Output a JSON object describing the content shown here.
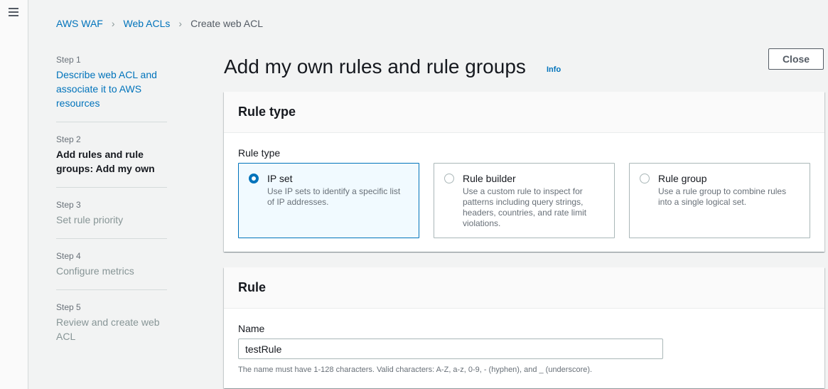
{
  "nav": {
    "menu_icon": "hamburger-menu-icon"
  },
  "breadcrumb": {
    "items": [
      {
        "label": "AWS WAF",
        "link": true
      },
      {
        "label": "Web ACLs",
        "link": true
      },
      {
        "label": "Create web ACL",
        "link": false
      }
    ],
    "separator": ">"
  },
  "steps": [
    {
      "step": "Step 1",
      "title": "Describe web ACL and associate it to AWS resources",
      "state": "link"
    },
    {
      "step": "Step 2",
      "title": "Add rules and rule groups: Add my own",
      "state": "active"
    },
    {
      "step": "Step 3",
      "title": "Set rule priority",
      "state": "disabled"
    },
    {
      "step": "Step 4",
      "title": "Configure metrics",
      "state": "disabled"
    },
    {
      "step": "Step 5",
      "title": "Review and create web ACL",
      "state": "disabled"
    }
  ],
  "header": {
    "title": "Add my own rules and rule groups",
    "info_label": "Info",
    "close_label": "Close"
  },
  "rule_type_panel": {
    "heading": "Rule type",
    "field_label": "Rule type",
    "options": [
      {
        "label": "IP set",
        "description": "Use IP sets to identify a specific list of IP addresses.",
        "selected": true
      },
      {
        "label": "Rule builder",
        "description": "Use a custom rule to inspect for patterns including query strings, headers, countries, and rate limit violations.",
        "selected": false
      },
      {
        "label": "Rule group",
        "description": "Use a rule group to combine rules into a single logical set.",
        "selected": false
      }
    ]
  },
  "rule_panel": {
    "heading": "Rule",
    "name_label": "Name",
    "name_value": "testRule",
    "name_hint": "The name must have 1-128 characters. Valid characters: A-Z, a-z, 0-9, - (hyphen), and _ (underscore)."
  },
  "colors": {
    "link": "#0073bb",
    "selected_tile_bg": "#f1faff",
    "page_bg": "#f2f3f3"
  }
}
